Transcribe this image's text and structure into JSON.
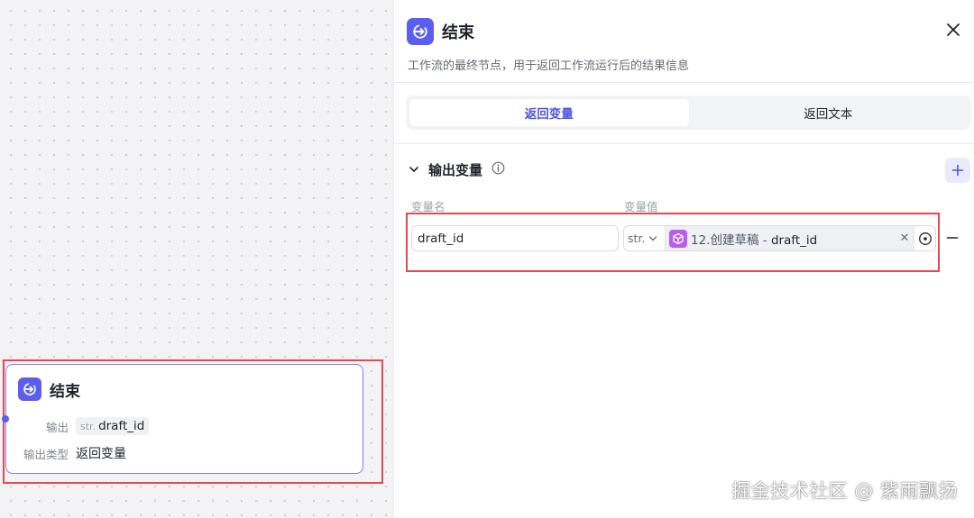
{
  "node": {
    "title": "结束",
    "output_label": "输出",
    "output_type_tag": "str.",
    "output_var": "draft_id",
    "output_type_label": "输出类型",
    "output_type_value": "返回变量"
  },
  "panel": {
    "title": "结束",
    "description": "工作流的最终节点，用于返回工作流运行后的结果信息",
    "tabs": [
      {
        "label": "返回变量",
        "active": true
      },
      {
        "label": "返回文本",
        "active": false
      }
    ],
    "section_title": "输出变量",
    "columns": {
      "name": "变量名",
      "value": "变量值"
    },
    "variables": [
      {
        "name": "draft_id",
        "type": "str.",
        "ref_node": "12.创建草稿",
        "ref_separator": "-",
        "ref_field": "draft_id"
      }
    ]
  },
  "watermark": "掘金技术社区 @ 紫雨飘扬",
  "colors": {
    "accent": "#4d53e8",
    "node_icon": "#5b5ef0",
    "ref_icon": "#b85cf2",
    "highlight": "#e5484d"
  },
  "icons": {
    "end_node": "exit-arrow-icon",
    "close": "close-icon",
    "collapse": "chevron-down-icon",
    "info": "info-icon",
    "add": "plus-icon",
    "type_dropdown": "chevron-down-icon",
    "ref_node": "cube-icon",
    "clear": "clear-icon",
    "target": "target-icon",
    "remove": "minus-icon"
  }
}
